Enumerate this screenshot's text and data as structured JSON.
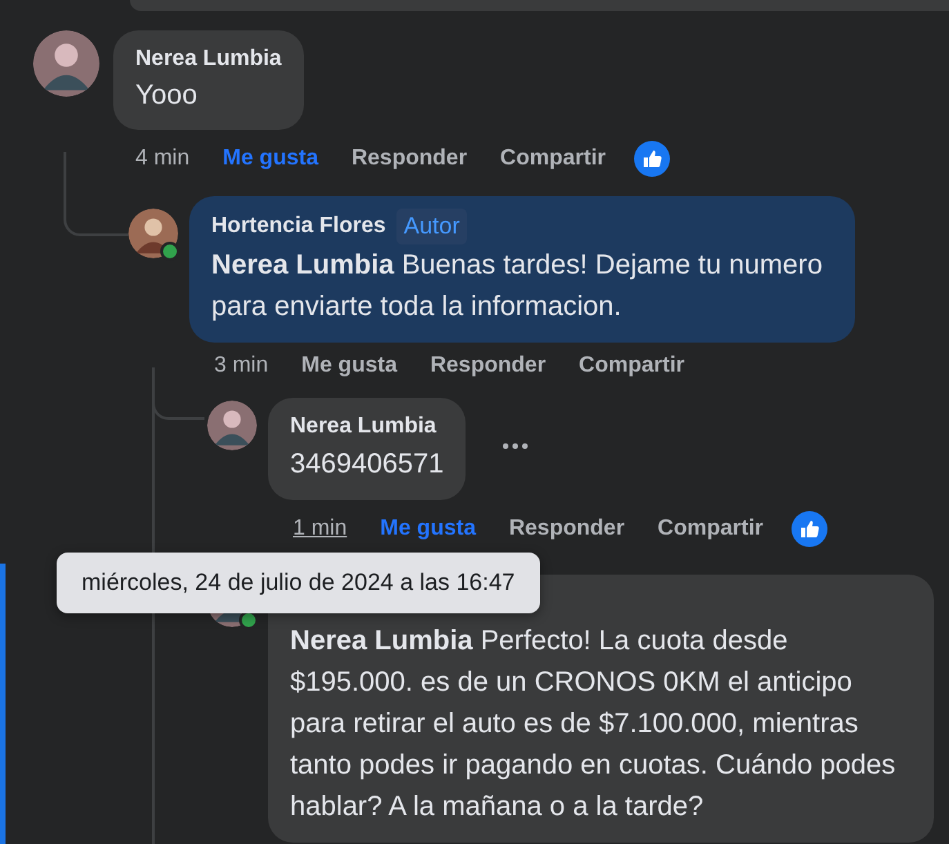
{
  "comments": [
    {
      "author": "Nerea Lumbia",
      "text": "Yooo",
      "time": {
        "text": "4 min",
        "hovered": false
      },
      "like": {
        "label": "Me gusta",
        "selected": true
      },
      "actions": [
        "Responder",
        "Compartir"
      ],
      "reaction": true,
      "highlighted": false,
      "children": [
        {
          "author": "Hortencia Flores",
          "badge": "Autor",
          "mention": "Nerea Lumbia",
          "text": "Buenas tardes! Dejame tu numero para enviarte toda la informacion.",
          "online": true,
          "highlighted": true,
          "time": {
            "text": "3 min",
            "hovered": false
          },
          "like": {
            "label": "Me gusta",
            "selected": false
          },
          "actions": [
            "Responder",
            "Compartir"
          ],
          "more_replies_below": true,
          "children": [
            {
              "author": "Nerea Lumbia",
              "text": "3469406571",
              "highlighted": false,
              "time": {
                "text": "1 min",
                "hovered": true,
                "tooltip": "miércoles, 24 de julio de 2024 a las 16:47"
              },
              "like": {
                "label": "Me gusta",
                "selected": true
              },
              "actions": [
                "Responder",
                "Compartir"
              ],
              "reaction": true,
              "more_menu": true
            },
            {
              "mention": "Nerea Lumbia",
              "text": "Perfecto! La cuota desde $195.000. es de un CRONOS 0KM el anticipo para retirar el auto es de $7.100.000, mientras tanto podes ir pagando en cuotas. Cuándo podes hablar? A la mañana o a la tarde?",
              "online": true,
              "highlighted": false,
              "selected": true
            }
          ]
        }
      ]
    }
  ]
}
